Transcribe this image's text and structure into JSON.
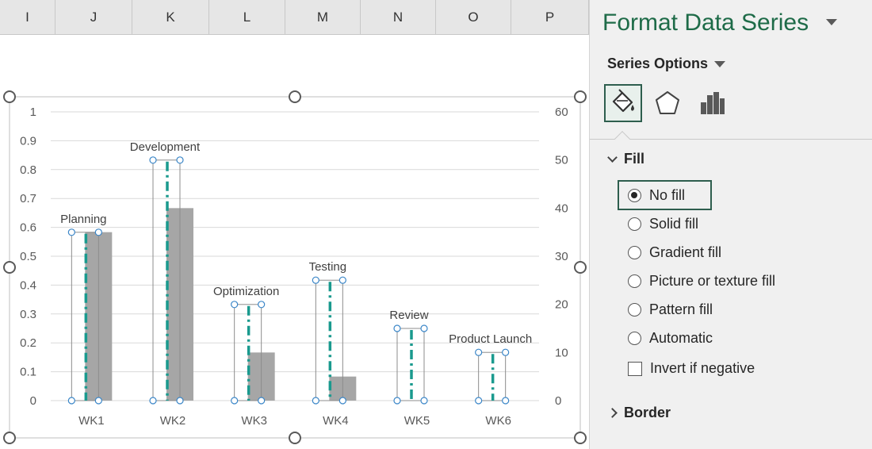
{
  "columns": [
    "I",
    "J",
    "K",
    "L",
    "M",
    "N",
    "O",
    "P"
  ],
  "pane": {
    "title": "Format Data Series",
    "series_options_label": "Series Options",
    "tabs": [
      {
        "name": "fill-line",
        "icon": "paint-bucket-icon",
        "active": true
      },
      {
        "name": "effects",
        "icon": "pentagon-icon",
        "active": false
      },
      {
        "name": "series-options",
        "icon": "bar-chart-icon",
        "active": false
      }
    ],
    "fill_section": "Fill",
    "fill_options": [
      {
        "label": "No fill",
        "selected": true
      },
      {
        "label": "Solid fill",
        "selected": false
      },
      {
        "label": "Gradient fill",
        "selected": false
      },
      {
        "label": "Picture or texture fill",
        "selected": false
      },
      {
        "label": "Pattern fill",
        "selected": false
      },
      {
        "label": "Automatic",
        "selected": false
      }
    ],
    "invert_label": "Invert if negative",
    "invert_checked": false,
    "border_section": "Border",
    "accent": "#1e6b48"
  },
  "chart_data": {
    "type": "bar",
    "categories": [
      "WK1",
      "WK2",
      "WK3",
      "WK4",
      "WK5",
      "WK6"
    ],
    "left_axis": {
      "ylim": [
        0,
        1
      ],
      "ticks": [
        "1",
        "0.9",
        "0.8",
        "0.7",
        "0.6",
        "0.5",
        "0.4",
        "0.3",
        "0.2",
        "0.1",
        "0"
      ]
    },
    "right_axis": {
      "ylim": [
        0,
        60
      ],
      "ticks": [
        "60",
        "50",
        "40",
        "30",
        "20",
        "10",
        "0"
      ]
    },
    "series": [
      {
        "role": "milestone-lines",
        "axis": "left",
        "style": "dash-dot",
        "color": "#1a9a8e",
        "values": [
          0.583,
          0.833,
          0.333,
          0.417,
          0.25,
          0.167
        ],
        "labels": [
          "Planning",
          "Development",
          "Optimization",
          "Testing",
          "Review",
          "Product Launch"
        ]
      },
      {
        "role": "duration-bars",
        "axis": "right",
        "color": "#a6a6a6",
        "values": [
          35,
          40,
          10,
          5,
          0,
          0
        ]
      }
    ],
    "gridlines": true,
    "legend": "none"
  }
}
